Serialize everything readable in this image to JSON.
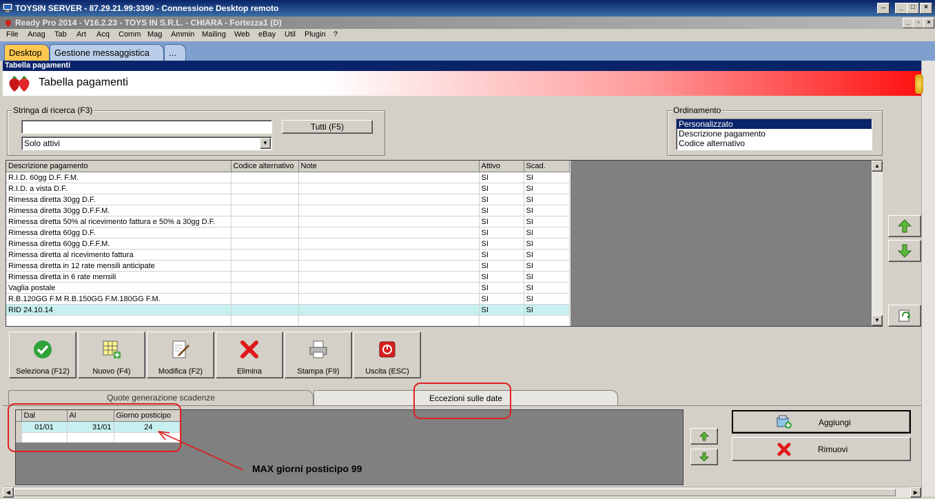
{
  "rdp": {
    "title": "TOYSIN SERVER - 87.29.21.99:3390 - Connessione Desktop remoto"
  },
  "app": {
    "title": "Ready Pro 2014 - V16.2.23 - TOYS IN S.R.L. - CHIARA - Fortezza1 (D)"
  },
  "menu": [
    "File",
    "Anag",
    "Tab",
    "Art",
    "Acq",
    "Comm",
    "Mag",
    "Ammin",
    "Mailing",
    "Web",
    "eBay",
    "Util",
    "Plugin",
    "?"
  ],
  "tabs": [
    "Desktop",
    "Gestione messaggistica",
    "..."
  ],
  "panel": {
    "header": "Tabella pagamenti",
    "banner_title": "Tabella pagamenti"
  },
  "search": {
    "legend": "Stringa di ricerca (F3)",
    "value": "",
    "filter": "Solo attivi",
    "all_button": "Tutti (F5)"
  },
  "ordering": {
    "legend": "Ordinamento",
    "options": [
      "Personalizzato",
      "Descrizione pagamento",
      "Codice alternativo"
    ]
  },
  "table": {
    "columns": [
      "Descrizione pagamento",
      "Codice alternativo",
      "Note",
      "Attivo",
      "Scad."
    ],
    "rows": [
      [
        "R.I.D. 60gg D.F. F.M.",
        "",
        "",
        "SI",
        "SI"
      ],
      [
        "R.I.D. a vista D.F.",
        "",
        "",
        "SI",
        "SI"
      ],
      [
        "Rimessa diretta 30gg D.F.",
        "",
        "",
        "SI",
        "SI"
      ],
      [
        "Rimessa diretta 30gg D.F.F.M.",
        "",
        "",
        "SI",
        "SI"
      ],
      [
        "Rimessa diretta 50% al ricevimento fattura e 50% a 30gg D.F.",
        "",
        "",
        "SI",
        "SI"
      ],
      [
        "Rimessa diretta 60gg D.F.",
        "",
        "",
        "SI",
        "SI"
      ],
      [
        "Rimessa diretta 60gg D.F.F.M.",
        "",
        "",
        "SI",
        "SI"
      ],
      [
        "Rimessa diretta al ricevimento fattura",
        "",
        "",
        "SI",
        "SI"
      ],
      [
        "Rimessa diretta in 12 rate mensili anticipate",
        "",
        "",
        "SI",
        "SI"
      ],
      [
        "Rimessa diretta in 6 rate mensili",
        "",
        "",
        "SI",
        "SI"
      ],
      [
        "Vaglia postale",
        "",
        "",
        "SI",
        "SI"
      ],
      [
        "R.B.120GG F.M R.B.150GG F.M.180GG F.M.",
        "",
        "",
        "SI",
        "SI"
      ],
      [
        "RID 24.10.14",
        "",
        "",
        "SI",
        "SI"
      ]
    ]
  },
  "toolbar": [
    "Seleziona (F12)",
    "Nuovo (F4)",
    "Modifica (F2)",
    "Elimina",
    "Stampa (F9)",
    "Uscita (ESC)"
  ],
  "subtabs": [
    "Quote generazione scadenze",
    "Eccezioni sulle date"
  ],
  "exceptions": {
    "columns": [
      "Dal",
      "Al",
      "Giorno posticipo"
    ],
    "rows": [
      [
        "01/01",
        "31/01",
        "24"
      ]
    ]
  },
  "actions": {
    "add": "Aggiungi",
    "remove": "Rimuovi"
  },
  "annotation": "MAX giorni posticipo 99"
}
